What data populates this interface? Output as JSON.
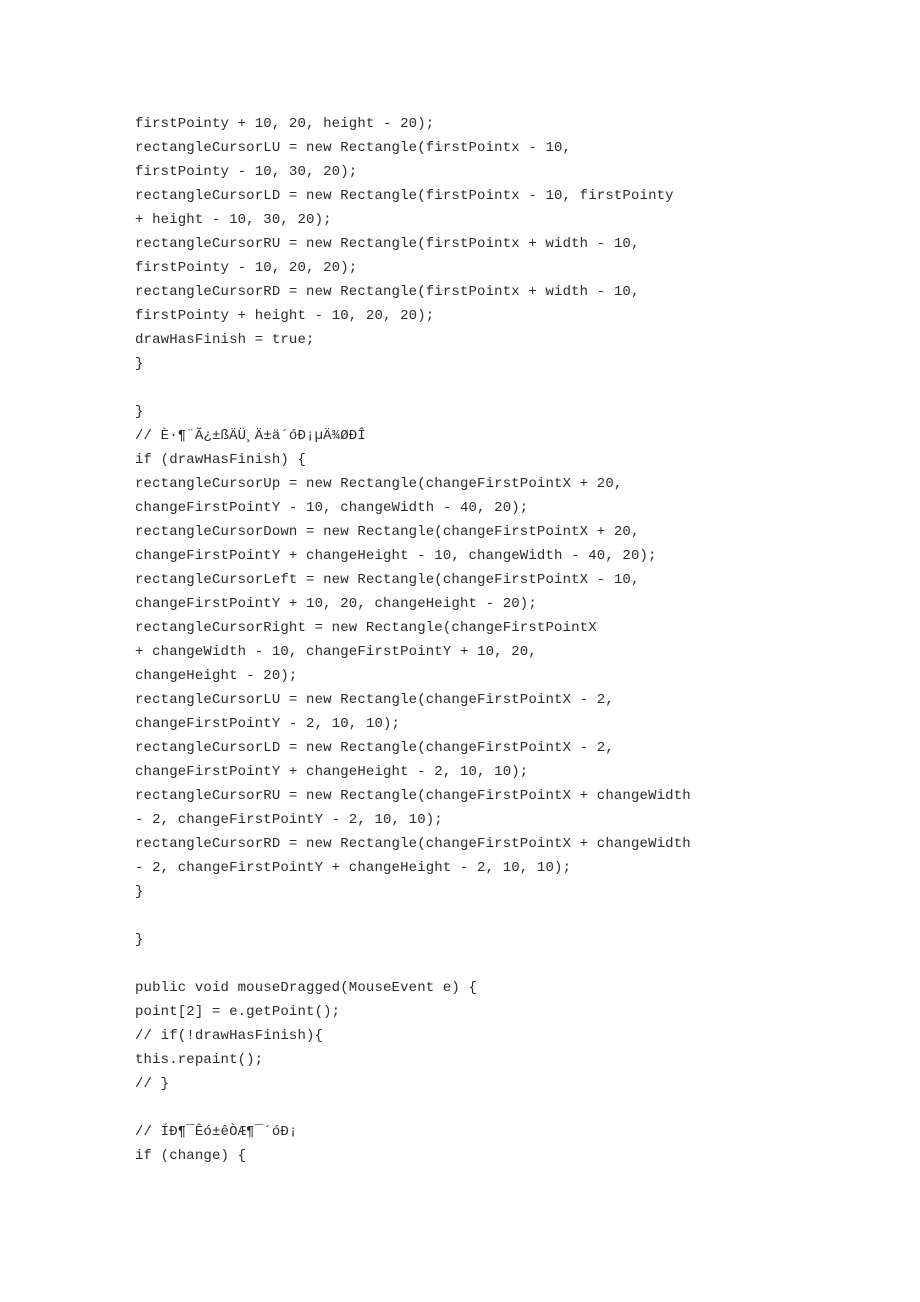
{
  "document": {
    "kind": "code-listing",
    "language": "Java",
    "background_color": "#ffffff",
    "text_color": "#2b2b2b",
    "lines": [
      "firstPointy + 10, 20, height - 20);",
      "rectangleCursorLU = new Rectangle(firstPointx - 10,",
      "firstPointy - 10, 30, 20);",
      "rectangleCursorLD = new Rectangle(firstPointx - 10, firstPointy",
      "+ height - 10, 30, 20);",
      "rectangleCursorRU = new Rectangle(firstPointx + width - 10,",
      "firstPointy - 10, 20, 20);",
      "rectangleCursorRD = new Rectangle(firstPointx + width - 10,",
      "firstPointy + height - 10, 20, 20);",
      "drawHasFinish = true;",
      "}",
      "",
      "}",
      "// È·¶¨Ã¿±ßÄÜ¸Ä±ä´óÐ¡µÄ¾ØÐÎ",
      "if (drawHasFinish) {",
      "rectangleCursorUp = new Rectangle(changeFirstPointX + 20,",
      "changeFirstPointY - 10, changeWidth - 40, 20);",
      "rectangleCursorDown = new Rectangle(changeFirstPointX + 20,",
      "changeFirstPointY + changeHeight - 10, changeWidth - 40, 20);",
      "rectangleCursorLeft = new Rectangle(changeFirstPointX - 10,",
      "changeFirstPointY + 10, 20, changeHeight - 20);",
      "rectangleCursorRight = new Rectangle(changeFirstPointX",
      "+ changeWidth - 10, changeFirstPointY + 10, 20,",
      "changeHeight - 20);",
      "rectangleCursorLU = new Rectangle(changeFirstPointX - 2,",
      "changeFirstPointY - 2, 10, 10);",
      "rectangleCursorLD = new Rectangle(changeFirstPointX - 2,",
      "changeFirstPointY + changeHeight - 2, 10, 10);",
      "rectangleCursorRU = new Rectangle(changeFirstPointX + changeWidth",
      "- 2, changeFirstPointY - 2, 10, 10);",
      "rectangleCursorRD = new Rectangle(changeFirstPointX + changeWidth",
      "- 2, changeFirstPointY + changeHeight - 2, 10, 10);",
      "}",
      "",
      "}",
      "",
      "public void mouseDragged(MouseEvent e) {",
      "point[2] = e.getPoint();",
      "// if(!drawHasFinish){",
      "this.repaint();",
      "// }",
      "",
      "// ÍÐ¶¯Êó±êÒÆ¶¯´óÐ¡",
      "if (change) {"
    ]
  }
}
